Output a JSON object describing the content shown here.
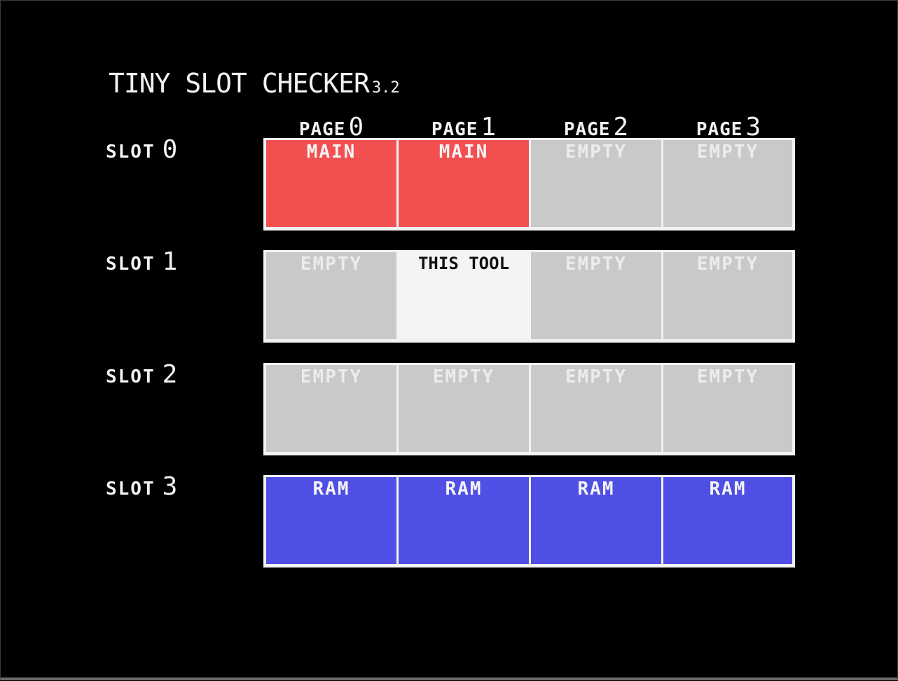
{
  "title": {
    "text": "TINY SLOT CHECKER",
    "version": "3.2"
  },
  "pages": [
    {
      "label": "PAGE",
      "num": "0"
    },
    {
      "label": "PAGE",
      "num": "1"
    },
    {
      "label": "PAGE",
      "num": "2"
    },
    {
      "label": "PAGE",
      "num": "3"
    }
  ],
  "slots": [
    {
      "label": "SLOT",
      "num": "0",
      "cells": [
        "MAIN",
        "MAIN",
        "EMPTY",
        "EMPTY"
      ]
    },
    {
      "label": "SLOT",
      "num": "1",
      "cells": [
        "EMPTY",
        "THIS TOOL",
        "EMPTY",
        "EMPTY"
      ]
    },
    {
      "label": "SLOT",
      "num": "2",
      "cells": [
        "EMPTY",
        "EMPTY",
        "EMPTY",
        "EMPTY"
      ]
    },
    {
      "label": "SLOT",
      "num": "3",
      "cells": [
        "RAM",
        "RAM",
        "RAM",
        "RAM"
      ]
    }
  ],
  "colors": {
    "background": "#000000",
    "main": "#f25050",
    "empty": "#c9c9c9",
    "this_tool": "#f4f4f4",
    "ram": "#4f4fe6",
    "grid_border": "#f2f2f2"
  }
}
